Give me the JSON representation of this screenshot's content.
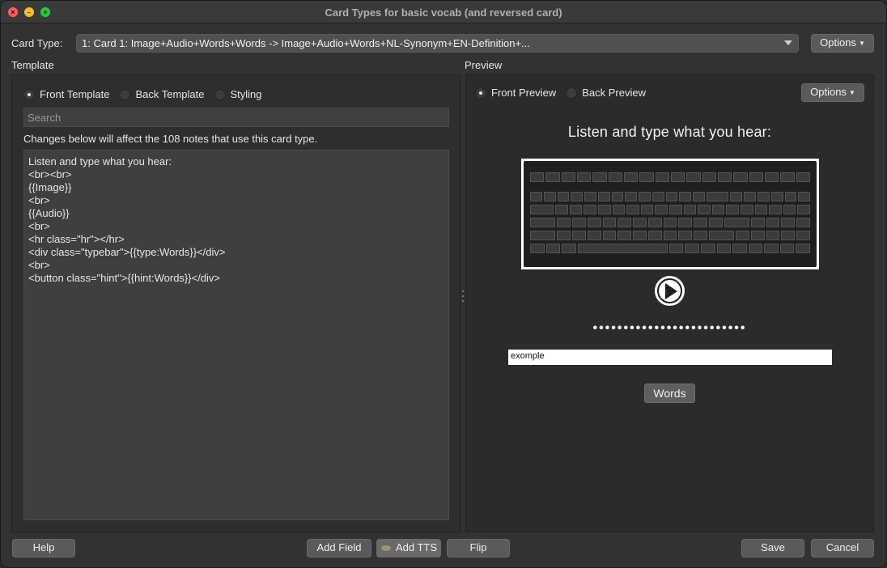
{
  "window": {
    "title": "Card Types for basic vocab (and reversed card)"
  },
  "card_type": {
    "label": "Card Type:",
    "selected": "1: Card 1: Image+Audio+Words+Words -> Image+Audio+Words+NL-Synonym+EN-Definition+...",
    "options_label": "Options"
  },
  "template": {
    "section_label": "Template",
    "radios": {
      "front": "Front Template",
      "back": "Back Template",
      "styling": "Styling"
    },
    "selected_radio": "front",
    "search_placeholder": "Search",
    "notice": "Changes below will affect the 108 notes that use this card type.",
    "editor_lines": [
      "Listen and type what you hear:",
      "<br><br>",
      "{{Image}}",
      "<br>",
      "{{Audio}}",
      "<br>",
      "<hr class=\"hr\"></hr>",
      "<div class=\"typebar\">{{type:Words}}</div>",
      "<br>",
      "<button class=\"hint\">{{hint:Words}}</div>"
    ]
  },
  "preview": {
    "section_label": "Preview",
    "radios": {
      "front": "Front Preview",
      "back": "Back Preview"
    },
    "selected_radio": "front",
    "options_label": "Options",
    "heading": "Listen and type what you hear:",
    "dots": "•••••••••••••••••••••••••",
    "typed_answer": "exomple",
    "hint_button": "Words"
  },
  "footer": {
    "help": "Help",
    "add_field": "Add Field",
    "add_tts": "Add TTS",
    "flip": "Flip",
    "save": "Save",
    "cancel": "Cancel"
  },
  "icons": {
    "close": "close-icon",
    "minimize": "minimize-icon",
    "zoom": "zoom-icon",
    "dropdown": "chevron-down-icon",
    "play": "play-icon",
    "tts": "tts-icon"
  }
}
